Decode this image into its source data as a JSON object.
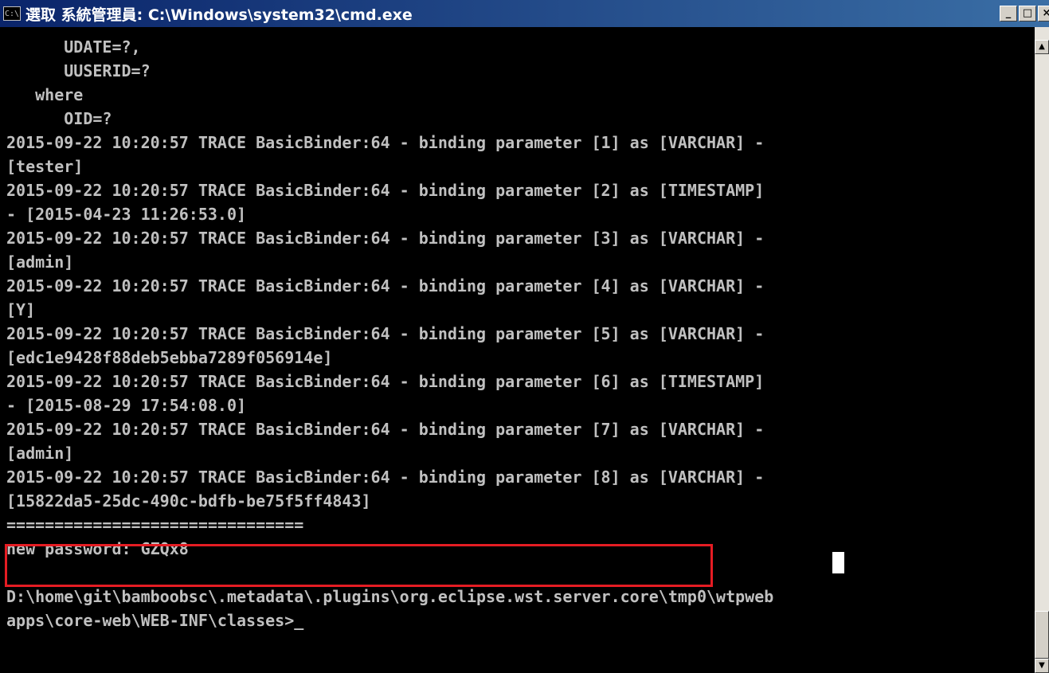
{
  "window": {
    "title": "選取 系統管理員: C:\\Windows\\system32\\cmd.exe",
    "icon_label": "C:\\",
    "buttons": {
      "minimize": "_",
      "maximize": "□",
      "close": "×"
    }
  },
  "console": {
    "lines": [
      "      UDATE=?,",
      "      UUSERID=?",
      "   where",
      "      OID=?",
      "2015-09-22 10:20:57 TRACE BasicBinder:64 - binding parameter [1] as [VARCHAR] -",
      "[tester]",
      "2015-09-22 10:20:57 TRACE BasicBinder:64 - binding parameter [2] as [TIMESTAMP]",
      "- [2015-04-23 11:26:53.0]",
      "2015-09-22 10:20:57 TRACE BasicBinder:64 - binding parameter [3] as [VARCHAR] -",
      "[admin]",
      "2015-09-22 10:20:57 TRACE BasicBinder:64 - binding parameter [4] as [VARCHAR] -",
      "[Y]",
      "2015-09-22 10:20:57 TRACE BasicBinder:64 - binding parameter [5] as [VARCHAR] -",
      "[edc1e9428f88deb5ebba7289f056914e]",
      "2015-09-22 10:20:57 TRACE BasicBinder:64 - binding parameter [6] as [TIMESTAMP]",
      "- [2015-08-29 17:54:08.0]",
      "2015-09-22 10:20:57 TRACE BasicBinder:64 - binding parameter [7] as [VARCHAR] -",
      "[admin]",
      "2015-09-22 10:20:57 TRACE BasicBinder:64 - binding parameter [8] as [VARCHAR] -",
      "[15822da5-25dc-490c-bdfb-be75f5ff4843]",
      "===============================",
      "new password: GZQx8",
      "",
      "D:\\home\\git\\bamboobsc\\.metadata\\.plugins\\org.eclipse.wst.server.core\\tmp0\\wtpweb",
      "apps\\core-web\\WEB-INF\\classes>_"
    ]
  },
  "colors": {
    "console_background": "#000000",
    "console_text": "#c0c0c0",
    "highlight_box": "#e51c23",
    "titlebar_start": "#0a246a",
    "titlebar_end": "#3a6ea5"
  }
}
